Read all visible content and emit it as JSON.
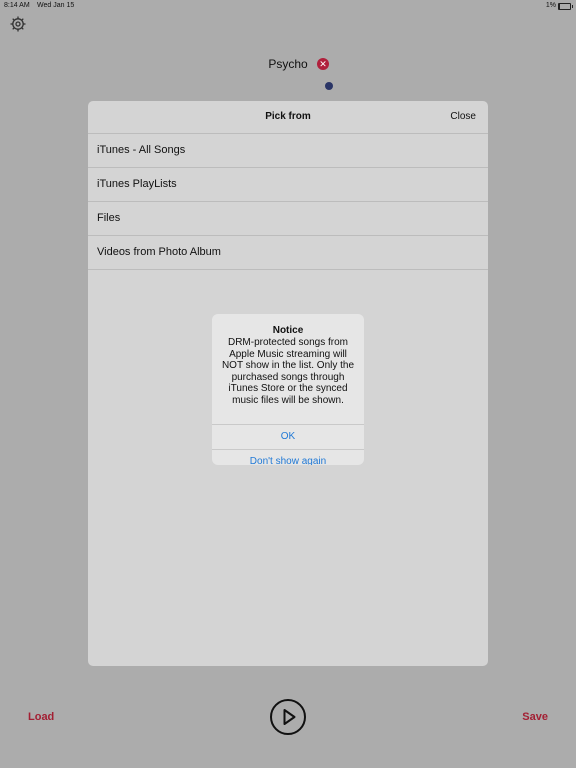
{
  "status_bar": {
    "time": "8:14 AM",
    "date": "Wed Jan 15",
    "battery_text": "1%",
    "battery_level": 0.01
  },
  "toolbar": {
    "settings_icon": "gear-icon"
  },
  "track": {
    "title": "Psycho",
    "remove_icon": "close-circle-icon",
    "remove_symbol": "✕"
  },
  "picker": {
    "title": "Pick from",
    "close_label": "Close",
    "items": [
      {
        "label": "iTunes - All Songs"
      },
      {
        "label": "iTunes PlayLists"
      },
      {
        "label": "Files"
      },
      {
        "label": "Videos from Photo Album"
      }
    ]
  },
  "alert": {
    "title": "Notice",
    "message": "DRM-protected songs from Apple Music streaming will NOT show in the list. Only the purchased songs through iTunes Store or the synced music files will be shown.",
    "ok_label": "OK",
    "dont_show_label": "Don't show again"
  },
  "bottom_bar": {
    "load_label": "Load",
    "save_label": "Save",
    "play_icon": "play-icon"
  },
  "colors": {
    "accent_red": "#a31f33",
    "link_blue": "#2079d6",
    "indicator_navy": "#2a3566"
  }
}
